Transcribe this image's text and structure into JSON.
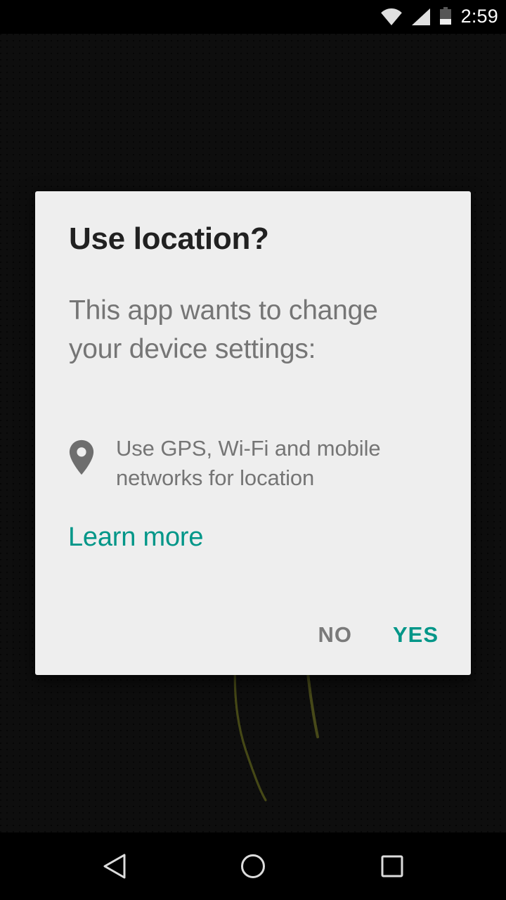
{
  "status_bar": {
    "time": "2:59",
    "icons": [
      {
        "name": "wifi-icon",
        "label": "Wi-Fi signal"
      },
      {
        "name": "cellular-signal-icon",
        "label": "Mobile signal"
      },
      {
        "name": "battery-icon",
        "label": "Battery"
      }
    ],
    "background_color": "#000000",
    "foreground_color": "#ffffff"
  },
  "wallpaper": {
    "background_color": "#121212",
    "accent_color": "#8a8f2a"
  },
  "dialog": {
    "title": "Use location?",
    "message": "This app wants to change your device settings:",
    "permission": {
      "icon": "location-pin-icon",
      "text": "Use GPS, Wi-Fi and mobile networks for location"
    },
    "link": "Learn more",
    "buttons": {
      "negative": "NO",
      "positive": "YES"
    },
    "background_color": "#eeeeee",
    "title_color": "#212121",
    "text_color": "#757575",
    "accent_color": "#009688",
    "negative_color": "#7a7a7a"
  },
  "nav_bar": {
    "background_color": "#000000",
    "buttons": [
      {
        "name": "back-button",
        "label": "Back"
      },
      {
        "name": "home-button",
        "label": "Home"
      },
      {
        "name": "recents-button",
        "label": "Recent apps"
      }
    ]
  }
}
